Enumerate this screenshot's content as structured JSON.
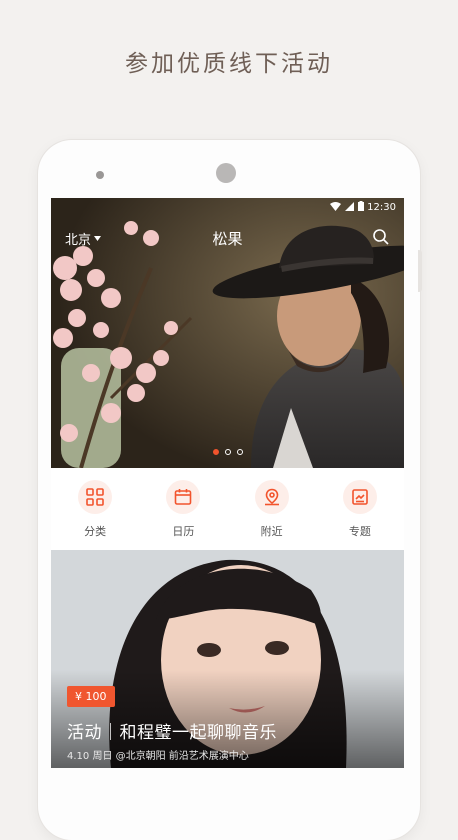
{
  "headline": "参加优质线下活动",
  "status": {
    "time": "12:30"
  },
  "appbar": {
    "city": "北京",
    "title": "松果"
  },
  "carousel": {
    "count": 3,
    "active": 0
  },
  "quicknav": [
    {
      "label": "分类",
      "icon": "grid-icon"
    },
    {
      "label": "日历",
      "icon": "calendar-icon"
    },
    {
      "label": "附近",
      "icon": "location-icon"
    },
    {
      "label": "专题",
      "icon": "topic-icon"
    }
  ],
  "card": {
    "price": "¥ 100",
    "title": "活动｜和程璧一起聊聊音乐",
    "meta": "4.10 周日 @北京朝阳 前沿艺术展演中心"
  },
  "colors": {
    "accent": "#f2542d",
    "headline": "#6f5f56"
  }
}
